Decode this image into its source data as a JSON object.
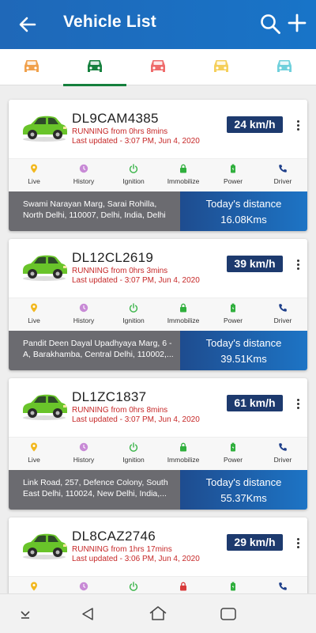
{
  "header": {
    "title": "Vehicle List",
    "back_icon": "arrow-left-icon",
    "search_icon": "search-icon",
    "add_icon": "plus-icon"
  },
  "tabs": [
    {
      "name": "all",
      "color": "#f0a04b"
    },
    {
      "name": "running",
      "color": "#15803d",
      "active": true
    },
    {
      "name": "stopped",
      "color": "#ef6b6b"
    },
    {
      "name": "idle",
      "color": "#f5cf5a"
    },
    {
      "name": "inactive",
      "color": "#6fd0dc"
    }
  ],
  "colors": {
    "accent": "#1f68b8",
    "status_red": "#c62828",
    "speed_badge": "#1d3a6e"
  },
  "actions": [
    "Live",
    "History",
    "Ignition",
    "Immobilize",
    "Power",
    "Driver"
  ],
  "distance_label": "Today's distance",
  "vehicles": [
    {
      "plate": "DL9CAM4385",
      "status": "RUNNING from 0hrs 8mins",
      "updated": "Last updated - 3:07 PM, Jun 4, 2020",
      "speed": "24 km/h",
      "address_line1": "Swami Narayan Marg, Sarai Rohilla,",
      "address_line2": "North Delhi, 110007, Delhi, India, Delhi",
      "distance": "16.08Kms",
      "immobilize_locked": false
    },
    {
      "plate": "DL12CL2619",
      "status": "RUNNING from 0hrs 3mins",
      "updated": "Last updated - 3:07 PM, Jun 4, 2020",
      "speed": "39 km/h",
      "address_line1": "Pandit Deen Dayal Upadhyaya Marg, 6 -",
      "address_line2": "A, Barakhamba, Central Delhi, 110002,...",
      "distance": "39.51Kms",
      "immobilize_locked": false
    },
    {
      "plate": "DL1ZC1837",
      "status": "RUNNING from 0hrs 8mins",
      "updated": "Last updated - 3:07 PM, Jun 4, 2020",
      "speed": "61 km/h",
      "address_line1": "Link Road, 257, Defence Colony, South",
      "address_line2": "East Delhi, 110024, New Delhi, India,...",
      "distance": "55.37Kms",
      "immobilize_locked": false
    },
    {
      "plate": "DL8CAZ2746",
      "status": "RUNNING from 1hrs 17mins",
      "updated": "Last updated - 3:06 PM, Jun 4, 2020",
      "speed": "29 km/h",
      "address_line1": "",
      "address_line2": "",
      "distance": "",
      "immobilize_locked": true
    }
  ],
  "navbar": {
    "icons": [
      "chevron-down-icon",
      "back-triangle-icon",
      "home-icon",
      "recents-icon"
    ]
  }
}
